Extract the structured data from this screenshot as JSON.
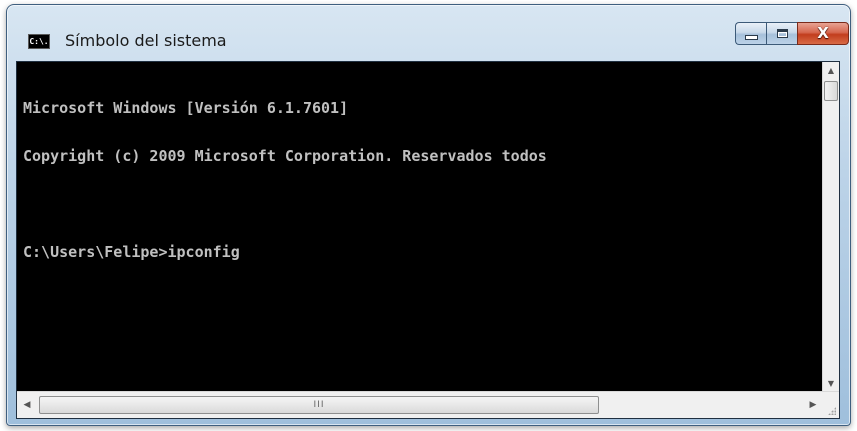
{
  "window": {
    "title": "Símbolo del sistema",
    "app_icon_text": "C:\\.",
    "icon_name": "console-icon"
  },
  "caption_buttons": {
    "close_glyph": "X"
  },
  "console": {
    "lines": [
      "Microsoft Windows [Versión 6.1.7601]",
      "Copyright (c) 2009 Microsoft Corporation. Reservados todos",
      "",
      "C:\\Users\\Felipe>ipconfig"
    ],
    "text_color": "#c0c0c0",
    "background_color": "#000000"
  },
  "scrollbars": {
    "up_arrow": "▲",
    "down_arrow": "▼",
    "left_arrow": "◀",
    "right_arrow": "▶",
    "h_thumb_grip": "III"
  },
  "colors": {
    "close_button": "#c23d1d",
    "frame": "#bcd3e8"
  }
}
